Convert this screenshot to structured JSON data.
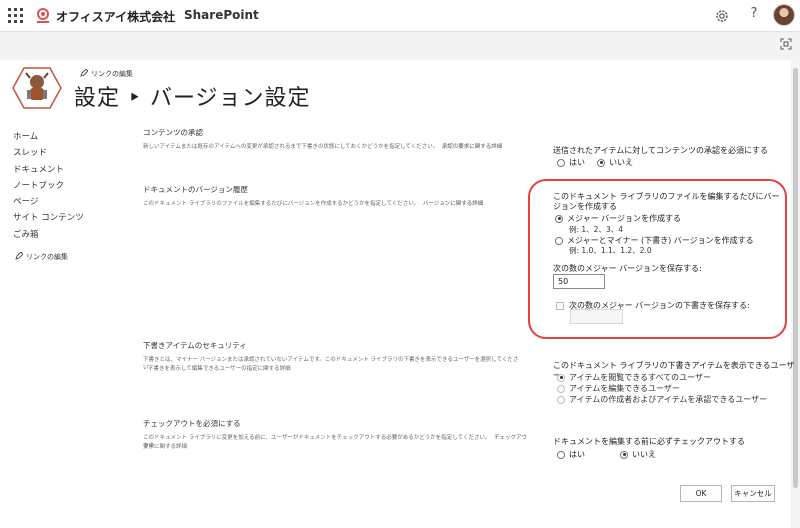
{
  "suitebar": {
    "org_name": "オフィスアイ株式会社",
    "app_name": "SharePoint",
    "help_label": "?"
  },
  "header": {
    "edit_links": "リンクの編集",
    "title": "設定 ‣ バージョン設定"
  },
  "leftnav": {
    "items": [
      "ホーム",
      "スレッド",
      "ドキュメント",
      "ノートブック",
      "ページ",
      "サイト コンテンツ",
      "ごみ箱"
    ],
    "edit_links": "リンクの編集"
  },
  "sections": {
    "approval": {
      "title": "コンテンツの承認",
      "desc": "新しいアイテムまたは既存のアイテムへの変更が承認されるまで下書きの状態にしておくかどうかを指定してください。",
      "link": "承認の要求に関する詳細",
      "question": "送信されたアイテムに対してコンテンツの承認を必須にする",
      "options": [
        "はい",
        "いいえ"
      ],
      "selected": "いいえ"
    },
    "versioning": {
      "title": "ドキュメントのバージョン履歴",
      "desc": "このドキュメント ライブラリのファイルを編集するたびにバージョンを作成するかどうかを指定してください。",
      "link": "バージョンに関する詳細",
      "question": "このドキュメント ライブラリのファイルを編集するたびにバージョンを作成する",
      "option_major": "メジャー バージョンを作成する",
      "example_major": "例: 1、2、3、4",
      "option_minor": "メジャーとマイナー (下書き) バージョンを作成する",
      "example_minor": "例: 1.0、1.1、1.2、2.0",
      "selected": "メジャー バージョンを作成する",
      "keep_major_label": "次の数のメジャー バージョンを保存する:",
      "keep_major_value": "50",
      "keep_drafts_label": "次の数のメジャー バージョンの下書きを保存する:",
      "keep_drafts_value": ""
    },
    "draft_security": {
      "title": "下書きアイテムのセキュリティ",
      "desc1": "下書きとは、マイナー バージョンまたは承認されていないアイテムです。このドキュメント ライブラリの下書きを表示できるユーザーを選択してください。",
      "desc2": "下書きを表示して編集できるユーザーの指定に関する詳細",
      "question": "このドキュメント ライブラリの下書きアイテムを表示できるユーザー",
      "options": [
        "アイテムを閲覧できるすべてのユーザー",
        "アイテムを編集できるユーザー",
        "アイテムの作成者およびアイテムを承認できるユーザー"
      ],
      "selected": "アイテムを閲覧できるすべてのユーザー"
    },
    "checkout": {
      "title": "チェックアウトを必須にする",
      "desc1": "このドキュメント ライブラリに変更を加える前に、ユーザーがドキュメントをチェックアウトする必要があるかどうかを指定してください。",
      "desc1_link": "チェックアウトの",
      "desc2": "要求に関する詳細",
      "question": "ドキュメントを編集する前に必ずチェックアウトする",
      "options": [
        "はい",
        "いいえ"
      ],
      "selected": "いいえ"
    }
  },
  "buttons": {
    "ok": "OK",
    "cancel": "キャンセル"
  },
  "colors": {
    "highlight": "#e8403a",
    "cmdbar": "#f3f3f3"
  }
}
